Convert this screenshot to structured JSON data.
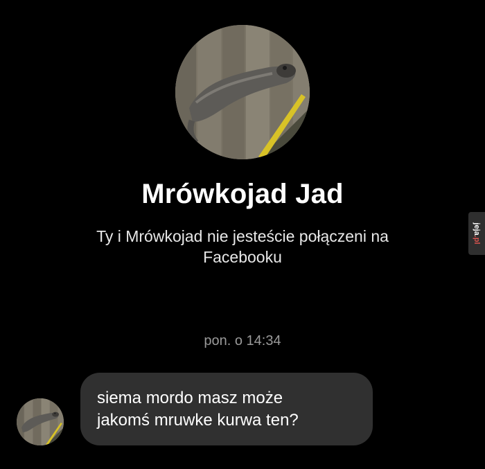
{
  "contact": {
    "name": "Mrówkojad Jad",
    "relation_line1": "Ty i Mrówkojad nie jesteście połączeni na",
    "relation_line2": "Facebooku"
  },
  "conversation": {
    "timestamp": "pon. o 14:34",
    "messages": [
      {
        "line1": "siema mordo masz może",
        "line2": "jakomś mruwke kurwa ten?"
      }
    ]
  },
  "watermark": {
    "text": "jeja.pl"
  },
  "colors": {
    "background": "#000000",
    "bubble": "#303030",
    "timestamp": "#9a9a9a",
    "watermark_accent": "#d9534f"
  },
  "icons": {
    "profile_picture": "anteater-photo-avatar",
    "message_avatar": "anteater-photo-avatar"
  }
}
